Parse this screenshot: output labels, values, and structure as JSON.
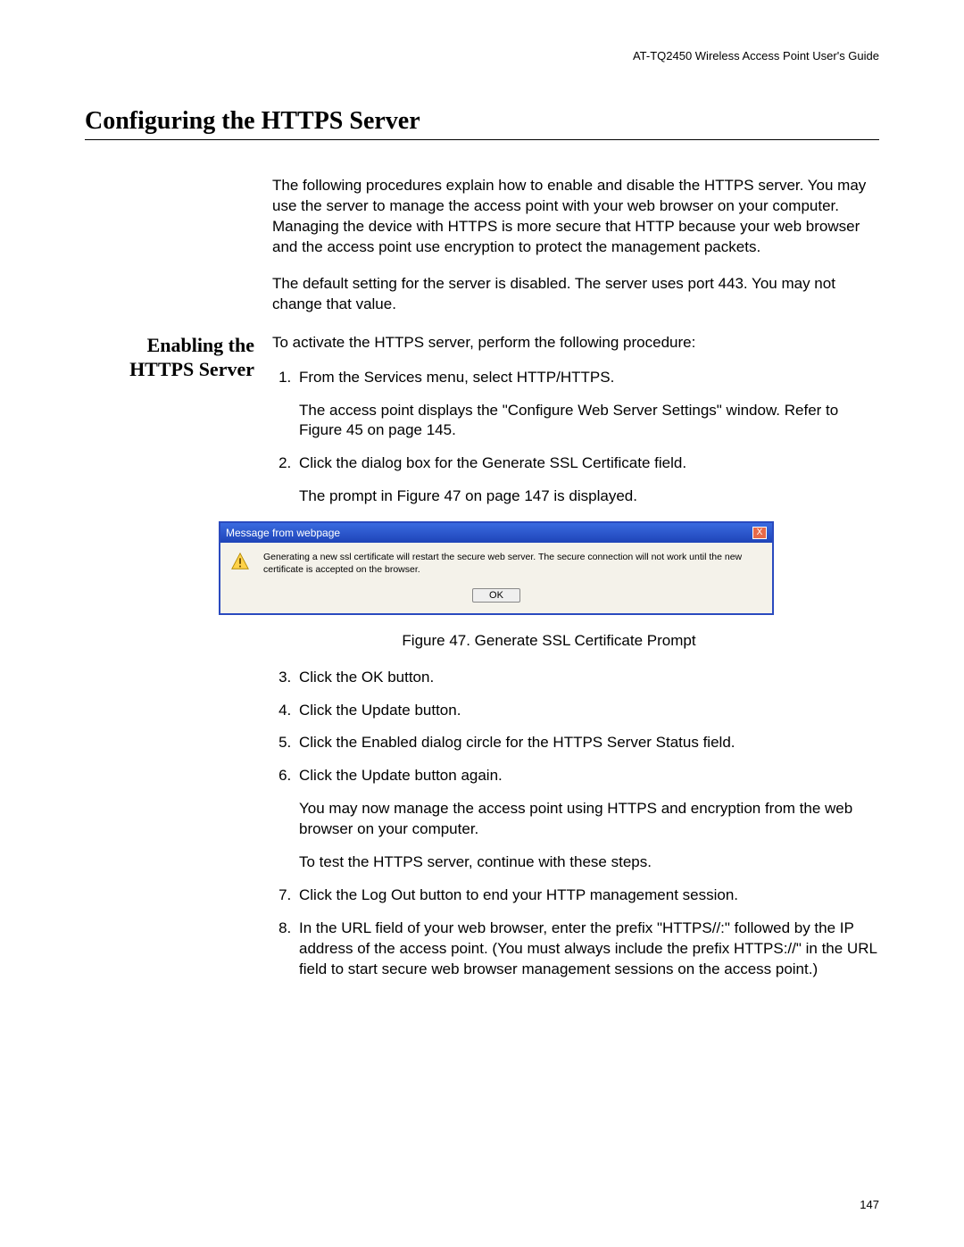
{
  "header": {
    "guide_title": "AT-TQ2450 Wireless Access Point User's Guide"
  },
  "title": "Configuring the HTTPS Server",
  "intro": {
    "p1": "The following procedures explain how to enable and disable the HTTPS server. You may use the server to manage the access point with your web browser on your computer. Managing the device with HTTPS is more secure that HTTP because your web browser and the access point use encryption to protect the management packets.",
    "p2": "The default setting for the server is disabled. The server uses port 443. You may not change that value."
  },
  "section1": {
    "heading_line1": "Enabling the",
    "heading_line2": "HTTPS Server",
    "lead": "To activate the HTTPS server, perform the following procedure:",
    "steps": {
      "s1": "From the Services menu, select HTTP/HTTPS.",
      "s1_note": "The access point displays the \"Configure Web Server Settings\" window. Refer to Figure 45 on page 145.",
      "s2": "Click the dialog box for the Generate SSL Certificate field.",
      "s2_note": "The prompt in Figure 47 on page 147 is displayed.",
      "s3": "Click the OK button.",
      "s4": "Click the Update button.",
      "s5": "Click the Enabled dialog circle for the HTTPS Server Status field.",
      "s6": "Click the Update button again.",
      "s6_note": "You may now manage the access point using HTTPS and encryption from the web browser on your computer.",
      "s6_test": "To test the HTTPS server, continue with these steps.",
      "s7": "Click the Log Out button to end your HTTP management session.",
      "s8": "In the URL field of your web browser, enter the prefix \"HTTPS//:\" followed by the IP address of the access point. (You must always include the prefix HTTPS://\" in the URL field to start secure web browser management sessions on the access point.)"
    }
  },
  "dialog": {
    "title": "Message from webpage",
    "message": "Generating a new ssl certificate will restart the secure web server. The secure connection will not work until the new certificate is accepted on the browser.",
    "ok_label": "OK",
    "close_label": "X"
  },
  "figure_caption": "Figure 47. Generate SSL Certificate Prompt",
  "page_number": "147"
}
